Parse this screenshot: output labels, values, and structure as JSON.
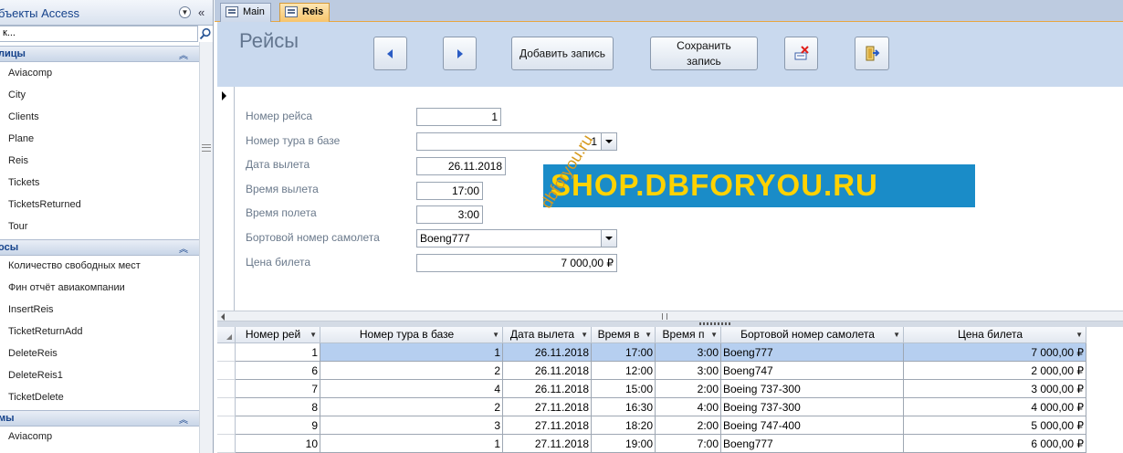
{
  "nav": {
    "title": "бъекты Access",
    "search_value": "к...",
    "groups": [
      {
        "label": "лицы",
        "items": [
          "Aviacomp",
          "City",
          "Clients",
          "Plane",
          "Reis",
          "Tickets",
          "TicketsReturned",
          "Tour"
        ]
      },
      {
        "label": "осы",
        "items": [
          "Количество свободных мест",
          "Фин отчёт авиакомпании",
          "InsertReis",
          "TicketReturnAdd",
          "DeleteReis",
          "DeleteReis1",
          "TicketDelete"
        ]
      },
      {
        "label": "мы",
        "items": [
          "Aviacomp"
        ]
      }
    ]
  },
  "tabs": [
    {
      "label": "Main",
      "active": false
    },
    {
      "label": "Reis",
      "active": true
    }
  ],
  "form": {
    "title": "Рейсы",
    "buttons": {
      "add": "Добавить запись",
      "save": "Сохранить запись"
    },
    "fields": [
      {
        "label": "Номер рейса",
        "value": "1"
      },
      {
        "label": "Номер тура в базе",
        "value": "1"
      },
      {
        "label": "Дата вылета",
        "value": "26.11.2018"
      },
      {
        "label": "Время вылета",
        "value": "17:00"
      },
      {
        "label": "Время полета",
        "value": "3:00"
      },
      {
        "label": "Бортовой номер самолета",
        "value": "Boeng777"
      },
      {
        "label": "Цена билета",
        "value": "7 000,00 ₽"
      }
    ],
    "banner": "SHOP.DBFORYOU.RU",
    "watermark": "dbforyou.ru"
  },
  "datasheet": {
    "columns": [
      "Номер рей",
      "Номер тура в базе",
      "Дата вылета",
      "Время в",
      "Время п",
      "Бортовой номер самолета",
      "Цена билета"
    ],
    "rows": [
      [
        "1",
        "1",
        "26.11.2018",
        "17:00",
        "3:00",
        "Boeng777",
        "7 000,00 ₽"
      ],
      [
        "6",
        "2",
        "26.11.2018",
        "12:00",
        "3:00",
        "Boeng747",
        "2 000,00 ₽"
      ],
      [
        "7",
        "4",
        "26.11.2018",
        "15:00",
        "2:00",
        "Boeing 737-300",
        "3 000,00 ₽"
      ],
      [
        "8",
        "2",
        "27.11.2018",
        "16:30",
        "4:00",
        "Boeing 737-300",
        "4 000,00 ₽"
      ],
      [
        "9",
        "3",
        "27.11.2018",
        "18:20",
        "2:00",
        "Boeing 747-400",
        "5 000,00 ₽"
      ],
      [
        "10",
        "1",
        "27.11.2018",
        "19:00",
        "7:00",
        "Boeng777",
        "6 000,00 ₽"
      ]
    ]
  },
  "colors": {
    "accent": "#15428b",
    "header_bg": "#c9d9ee",
    "selected_row": "#b6cff0",
    "banner_bg": "#1a8cc8",
    "banner_text": "#ffd200"
  }
}
